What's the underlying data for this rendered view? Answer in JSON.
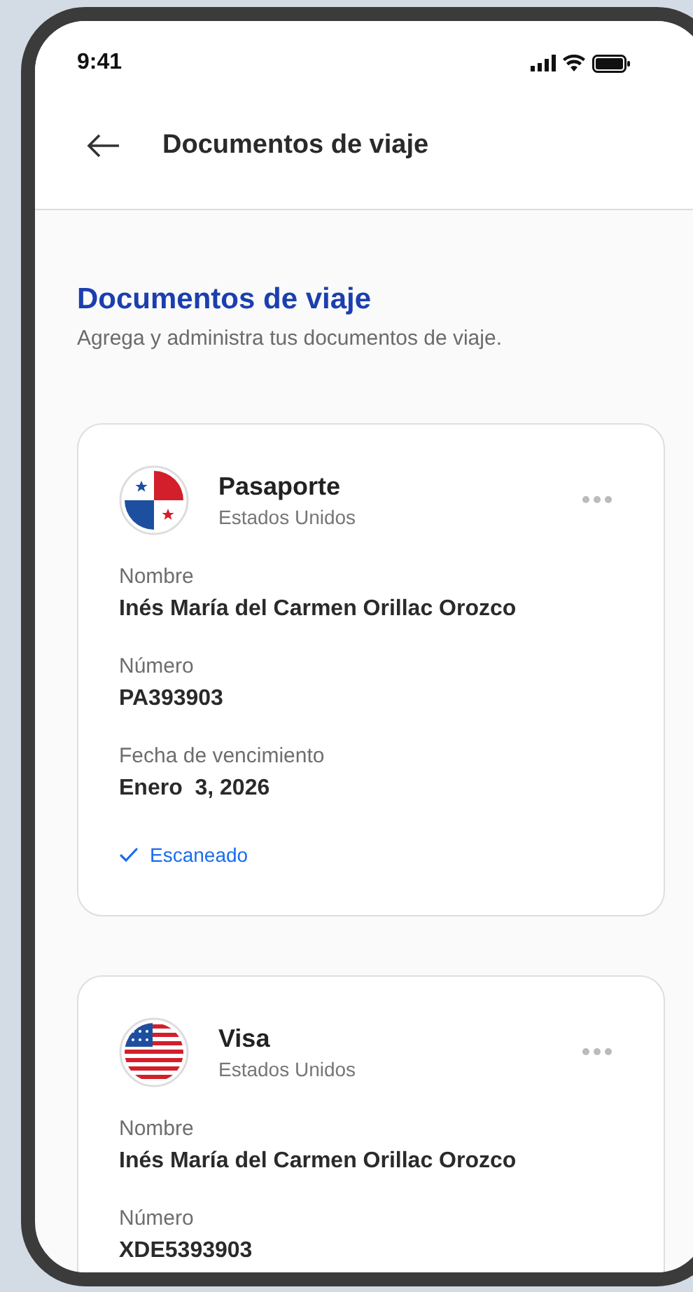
{
  "status_bar": {
    "time": "9:41"
  },
  "header": {
    "title": "Documentos de viaje"
  },
  "page": {
    "heading": "Documentos de viaje",
    "subtitle": "Agrega y administra tus documentos de viaje."
  },
  "documents": [
    {
      "type": "Pasaporte",
      "country": "Estados Unidos",
      "kind": "panama",
      "fields": [
        {
          "label": "Nombre",
          "value": "Inés María del Carmen Orillac Orozco"
        },
        {
          "label": "Número",
          "value": "PA393903"
        },
        {
          "label": "Fecha de vencimiento",
          "value": "Enero  3, 2026"
        }
      ],
      "status": "Escaneado"
    },
    {
      "type": "Visa",
      "country": "Estados Unidos",
      "kind": "usa",
      "fields": [
        {
          "label": "Nombre",
          "value": "Inés María del Carmen Orillac Orozco"
        },
        {
          "label": "Número",
          "value": "XDE5393903"
        }
      ]
    }
  ]
}
